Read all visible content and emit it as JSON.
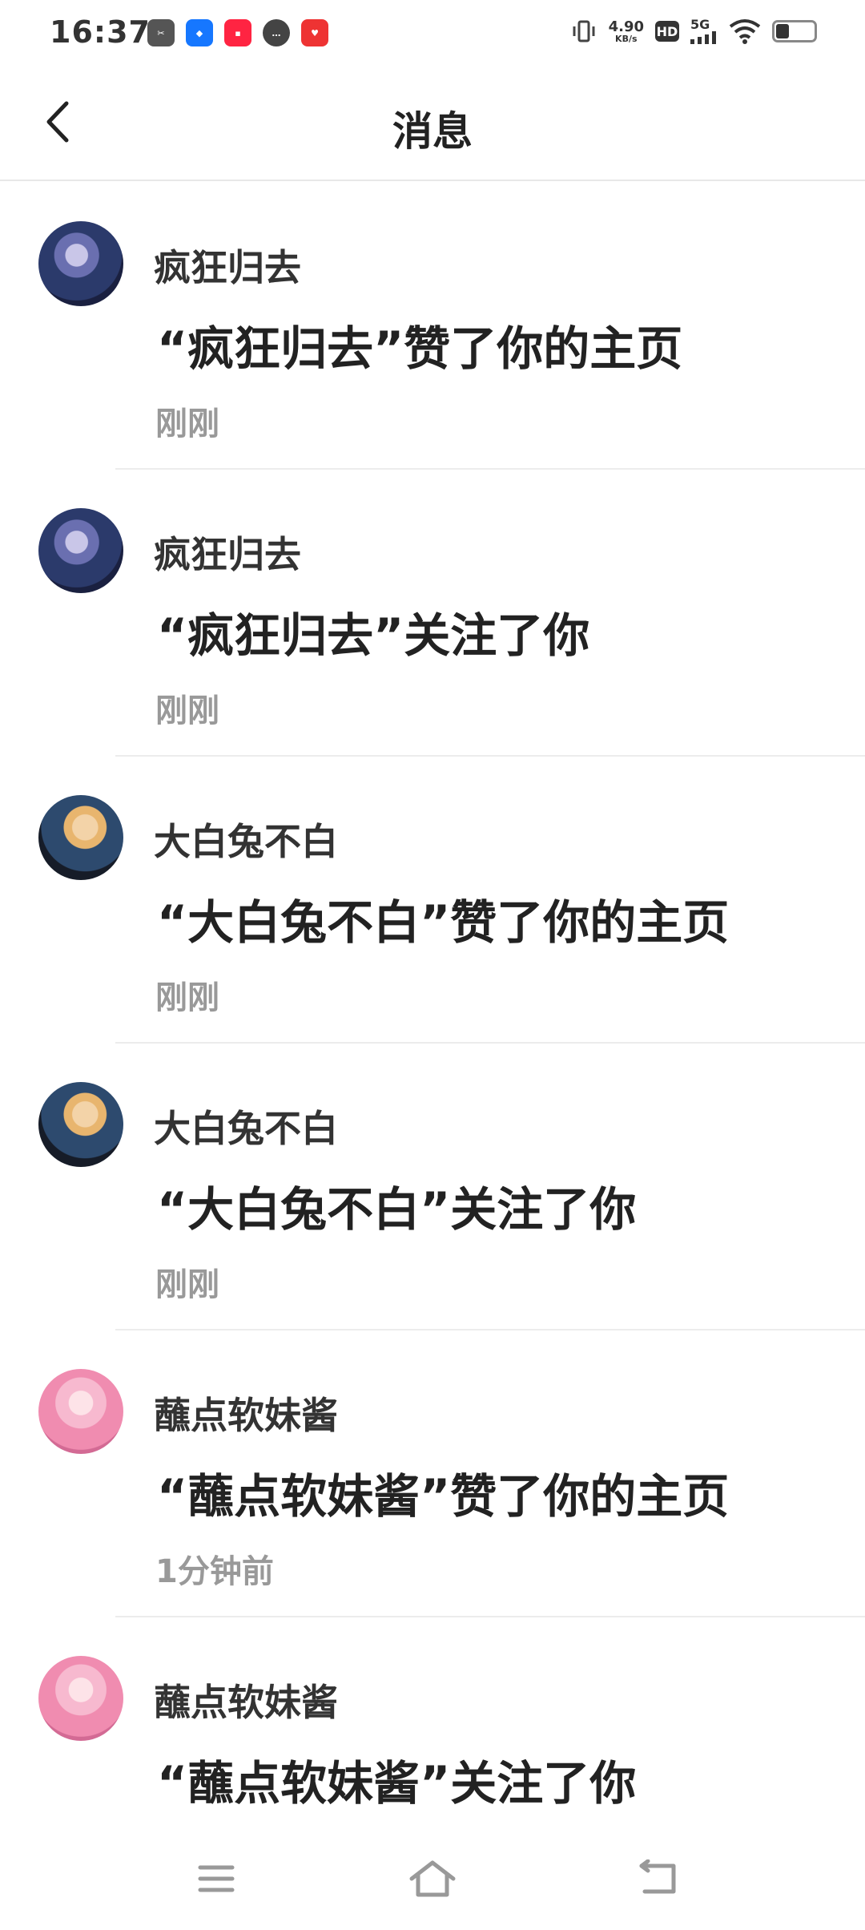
{
  "status_bar": {
    "time": "16:37",
    "net_speed_value": "4.90",
    "net_speed_unit": "KB/s",
    "hd": "HD",
    "network": "5G"
  },
  "header": {
    "title": "消息"
  },
  "messages": [
    {
      "nickname": "疯狂归去",
      "text": "“疯狂归去”赞了你的主页",
      "time": "刚刚",
      "avatar_color": "#2b3a6b"
    },
    {
      "nickname": "疯狂归去",
      "text": "“疯狂归去”关注了你",
      "time": "刚刚",
      "avatar_color": "#2b3a6b"
    },
    {
      "nickname": "大白兔不白",
      "text": "“大白兔不白”赞了你的主页",
      "time": "刚刚",
      "avatar_color": "#2d4a6e"
    },
    {
      "nickname": "大白兔不白",
      "text": "“大白兔不白”关注了你",
      "time": "刚刚",
      "avatar_color": "#2d4a6e"
    },
    {
      "nickname": "蘸点软妹酱",
      "text": "“蘸点软妹酱”赞了你的主页",
      "time": "1分钟前",
      "avatar_color": "#f2a6c4"
    },
    {
      "nickname": "蘸点软妹酱",
      "text": "“蘸点软妹酱”关注了你",
      "time": "",
      "avatar_color": "#f2a6c4"
    }
  ]
}
